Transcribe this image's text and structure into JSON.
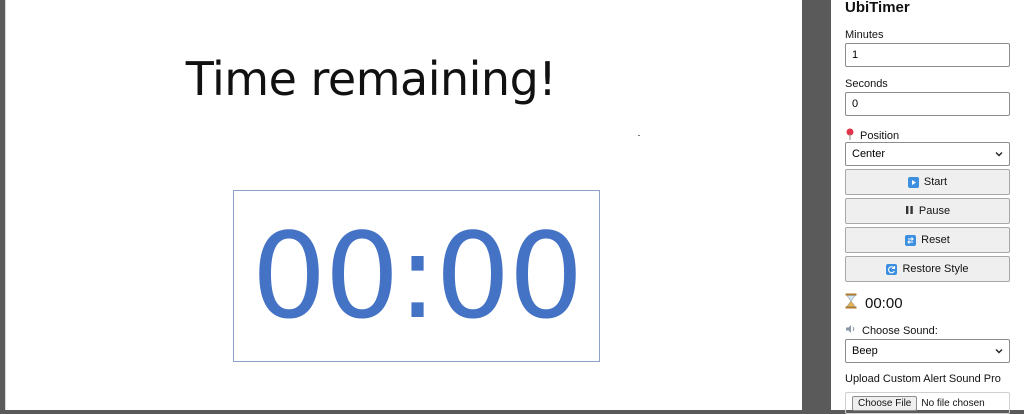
{
  "slide": {
    "title": "Time remaining!",
    "timer_display": "00:00",
    "timer_color": "#4472c4"
  },
  "panel": {
    "title": "UbiTimer",
    "minutes_label": "Minutes",
    "minutes_value": "1",
    "seconds_label": "Seconds",
    "seconds_value": "0",
    "position_icon": "pin-icon",
    "position_label": "Position",
    "position_value": "Center",
    "start_label": "Start",
    "pause_label": "Pause",
    "reset_label": "Reset",
    "restore_label": "Restore Style",
    "countdown_icon": "hourglass-icon",
    "countdown_value": "00:00",
    "sound_icon": "speaker-icon",
    "sound_label": "Choose Sound:",
    "sound_value": "Beep",
    "upload_label": "Upload Custom Alert Sound Pro",
    "choose_file_label": "Choose File",
    "no_file_text": "No file chosen"
  },
  "colors": {
    "accent": "#3d8fe0",
    "backdrop": "#5a5a5a"
  }
}
